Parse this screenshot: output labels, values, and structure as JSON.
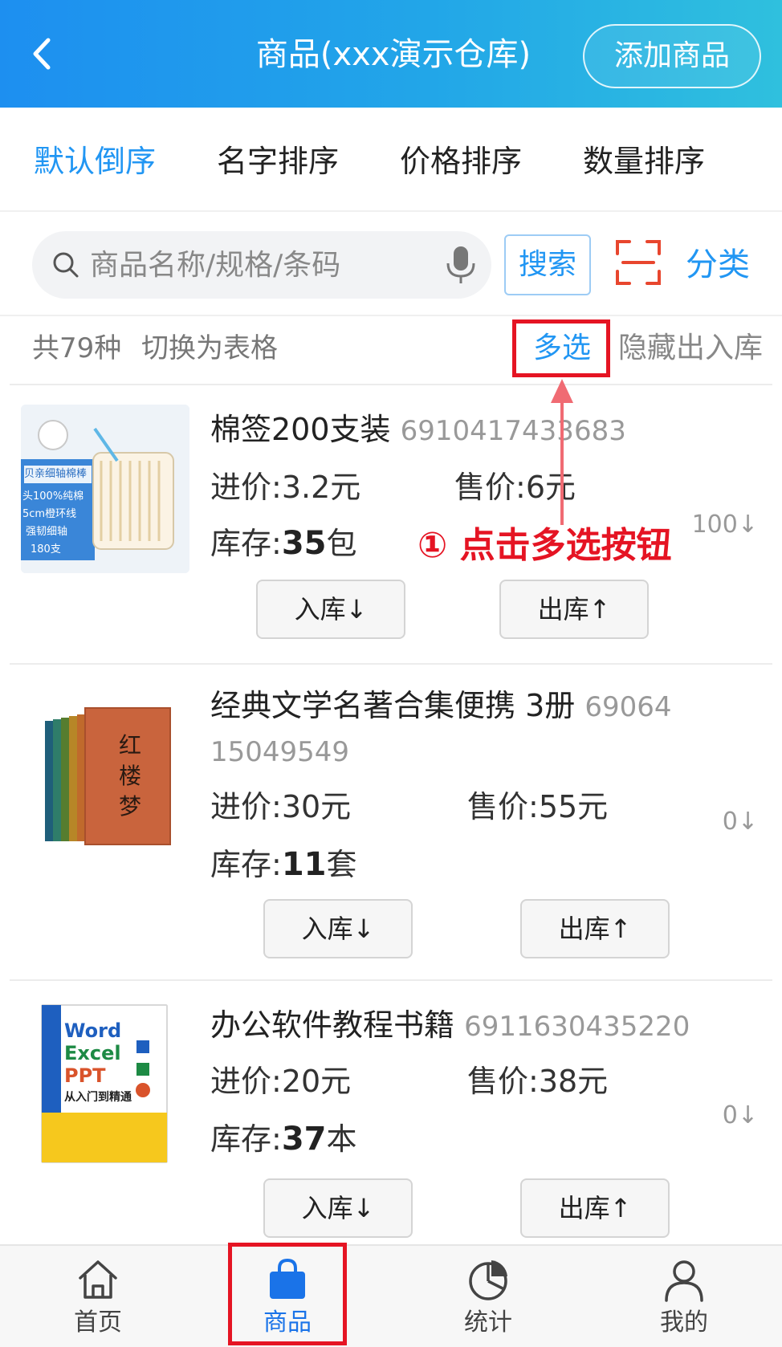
{
  "header": {
    "title": "商品(xxx演示仓库)",
    "add_button": "添加商品"
  },
  "sort_tabs": [
    {
      "label": "默认倒序",
      "active": true
    },
    {
      "label": "名字排序",
      "active": false
    },
    {
      "label": "价格排序",
      "active": false
    },
    {
      "label": "数量排序",
      "active": false
    }
  ],
  "search": {
    "placeholder": "商品名称/规格/条码",
    "button": "搜索",
    "category": "分类"
  },
  "info": {
    "count": "共79种",
    "switch_view": "切换为表格",
    "multi_select": "多选",
    "hide_io": "隐藏出入库"
  },
  "annotation": {
    "text": "① 点击多选按钮",
    "color": "#e51423"
  },
  "products": [
    {
      "name": "棉签200支装",
      "code": "6910417433683",
      "cost_label": "进价:",
      "cost": "3.2元",
      "price_label": "售价:",
      "price": "6元",
      "stock_label": "库存:",
      "stock_value": "35",
      "stock_unit": "包",
      "side": "100↓",
      "in_button": "入库↓",
      "out_button": "出库↑",
      "thumb_text": [
        "贝亲细轴棉棒",
        "头100%纯棉",
        "5cm橙环线",
        "强韧细轴",
        "180支"
      ]
    },
    {
      "name": "经典文学名著合集便携  3册",
      "code_line1": "69064",
      "code_line2": "15049549",
      "cost_label": "进价:",
      "cost": "30元",
      "price_label": "售价:",
      "price": "55元",
      "stock_label": "库存:",
      "stock_value": "11",
      "stock_unit": "套",
      "side": "0↓",
      "in_button": "入库↓",
      "out_button": "出库↑",
      "thumb_text": [
        "红",
        "楼",
        "梦"
      ]
    },
    {
      "name": "办公软件教程书籍",
      "code": "6911630435220",
      "cost_label": "进价:",
      "cost": "20元",
      "price_label": "售价:",
      "price": "38元",
      "stock_label": "库存:",
      "stock_value": "37",
      "stock_unit": "本",
      "side": "0↓",
      "in_button": "入库↓",
      "out_button": "出库↑",
      "thumb_text": [
        "Word",
        "Excel",
        "PPT",
        "从入门到精通"
      ]
    }
  ],
  "bottom_nav": [
    {
      "label": "首页",
      "icon": "home-icon",
      "active": false
    },
    {
      "label": "商品",
      "icon": "bag-icon",
      "active": true
    },
    {
      "label": "统计",
      "icon": "pie-chart-icon",
      "active": false
    },
    {
      "label": "我的",
      "icon": "user-icon",
      "active": false
    }
  ],
  "colors": {
    "accent": "#2196f3",
    "annotation_red": "#e51423",
    "header_start": "#1d8ff0",
    "header_end": "#2fc0de"
  }
}
